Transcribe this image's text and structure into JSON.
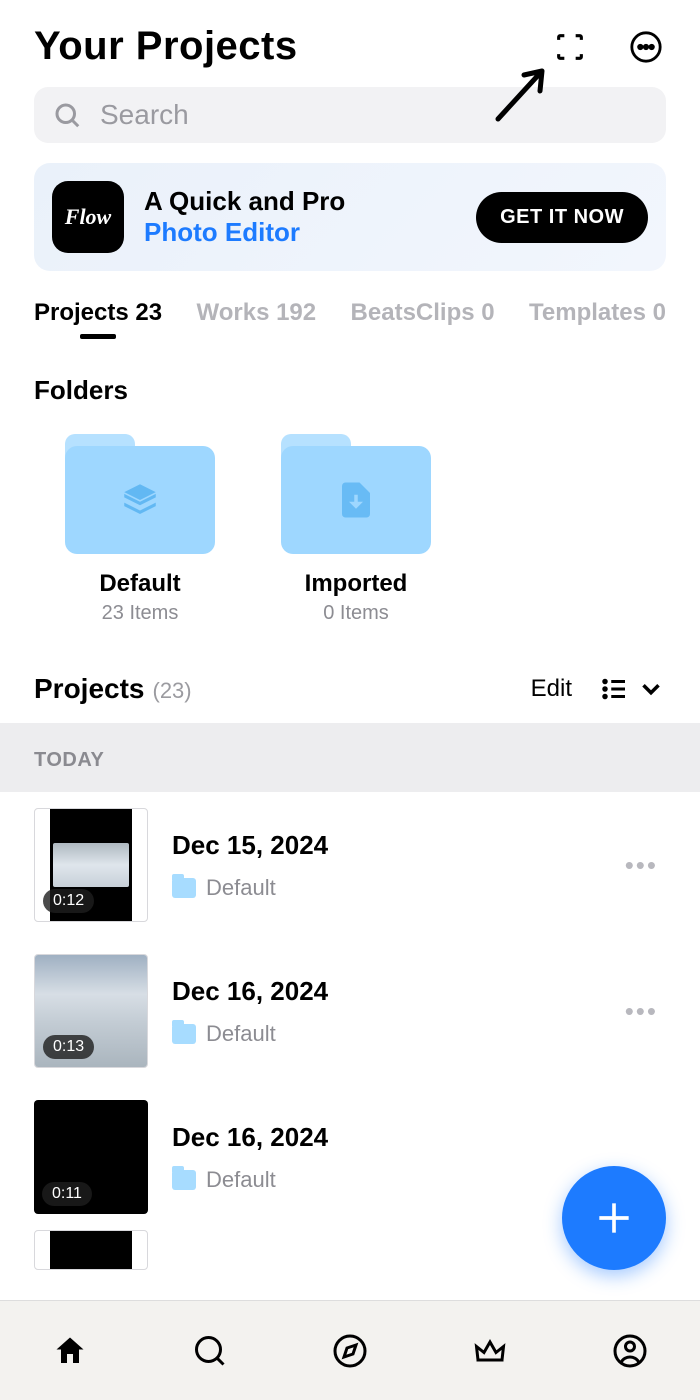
{
  "header": {
    "title": "Your Projects"
  },
  "search": {
    "placeholder": "Search"
  },
  "promo": {
    "icon_text": "Flow",
    "line1": "A Quick and Pro",
    "line2": "Photo Editor",
    "cta": "GET IT NOW"
  },
  "tabs": [
    {
      "label": "Projects 23",
      "active": true
    },
    {
      "label": "Works 192",
      "active": false
    },
    {
      "label": "BeatsClips 0",
      "active": false
    },
    {
      "label": "Templates 0",
      "active": false
    }
  ],
  "folders_heading": "Folders",
  "folders": [
    {
      "name": "Default",
      "sub": "23 Items"
    },
    {
      "name": "Imported",
      "sub": "0 Items"
    }
  ],
  "projects_section": {
    "title": "Projects",
    "count": "(23)",
    "edit": "Edit"
  },
  "date_separator": "TODAY",
  "projects": [
    {
      "date": "Dec 15, 2024",
      "folder": "Default",
      "duration": "0:12"
    },
    {
      "date": "Dec 16, 2024",
      "folder": "Default",
      "duration": "0:13"
    },
    {
      "date": "Dec 16, 2024",
      "folder": "Default",
      "duration": "0:11"
    }
  ]
}
